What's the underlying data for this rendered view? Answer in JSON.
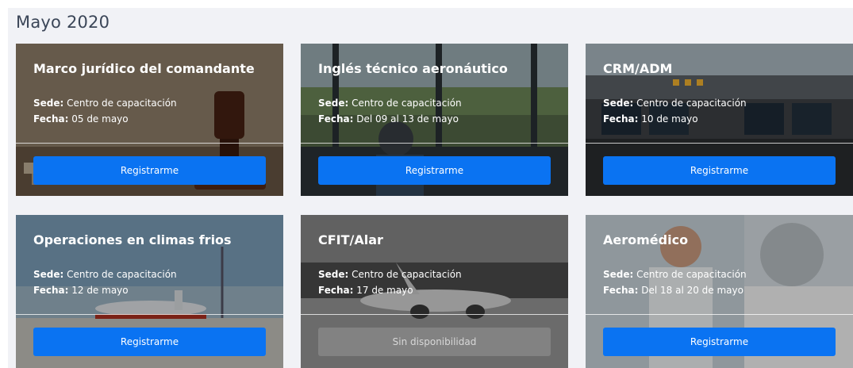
{
  "page": {
    "title": "Mayo 2020"
  },
  "labels": {
    "sede": "Sede:",
    "fecha": "Fecha:"
  },
  "cards": [
    {
      "title": "Marco jurídico del comandante",
      "sede": "Centro de capacitación",
      "fecha": "05 de mayo",
      "button": "Registrarme",
      "available": true,
      "image": "gavel-books"
    },
    {
      "title": "Inglés técnico aeronáutico",
      "sede": "Centro de capacitación",
      "fecha": "Del 09 al 13 de mayo",
      "button": "Registrarme",
      "available": true,
      "image": "control-tower"
    },
    {
      "title": "CRM/ADM",
      "sede": "Centro de capacitación",
      "fecha": "10 de mayo",
      "button": "Registrarme",
      "available": true,
      "image": "cockpit"
    },
    {
      "title": "Operaciones en climas frios",
      "sede": "Centro de capacitación",
      "fecha": "12 de mayo",
      "button": "Registrarme",
      "available": true,
      "image": "airplane-deicing"
    },
    {
      "title": "CFIT/Alar",
      "sede": "Centro de capacitación",
      "fecha": "17 de mayo",
      "button": "Sin disponibilidad",
      "available": false,
      "image": "airplane-grayscale"
    },
    {
      "title": "Aeromédico",
      "sede": "Centro de capacitación",
      "fecha": "Del 18 al 20 de mayo",
      "button": "Registrarme",
      "available": true,
      "image": "doctor-pilot"
    }
  ],
  "colors": {
    "button": "#0a73f2",
    "button_disabled": "#9a9a9a",
    "background": "#f1f2f6",
    "title": "#3b4658"
  }
}
